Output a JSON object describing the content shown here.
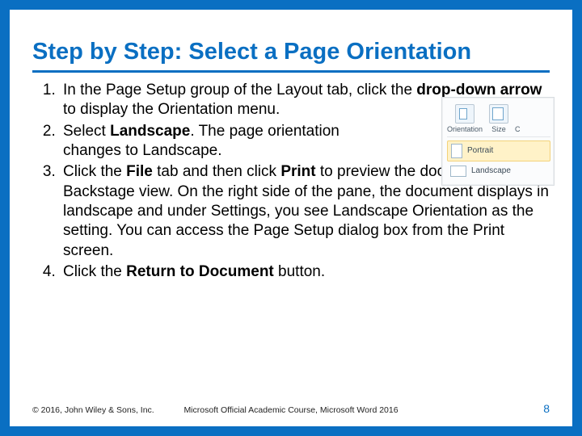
{
  "title": "Step by Step: Select a Page Orientation",
  "steps": [
    {
      "pre": "In the Page Setup group of the Layout tab, click the ",
      "bold": "drop-down arrow",
      "post": " to display the Orientation menu."
    },
    {
      "pre": "Select ",
      "bold": "Landscape",
      "post": ". The page orientation changes to Landscape."
    },
    {
      "pre": "Click the ",
      "bold": "File",
      "mid": " tab and then click ",
      "bold2": "Print",
      "post": " to preview the document in Backstage view. On the right side of the pane, the document displays in landscape and under Settings, you see Landscape Orientation as the setting. You can access the Page Setup dialog box from the Print screen."
    },
    {
      "pre": "Click the ",
      "bold": "Return to Document",
      "post": " button."
    }
  ],
  "inset": {
    "orientation_label": "Orientation",
    "size_label": "Size",
    "c_label": "C",
    "menu_portrait": "Portrait",
    "menu_landscape": "Landscape"
  },
  "footer": {
    "left": "© 2016, John Wiley & Sons, Inc.",
    "center": "Microsoft Official Academic Course, Microsoft Word 2016",
    "page": "8"
  }
}
